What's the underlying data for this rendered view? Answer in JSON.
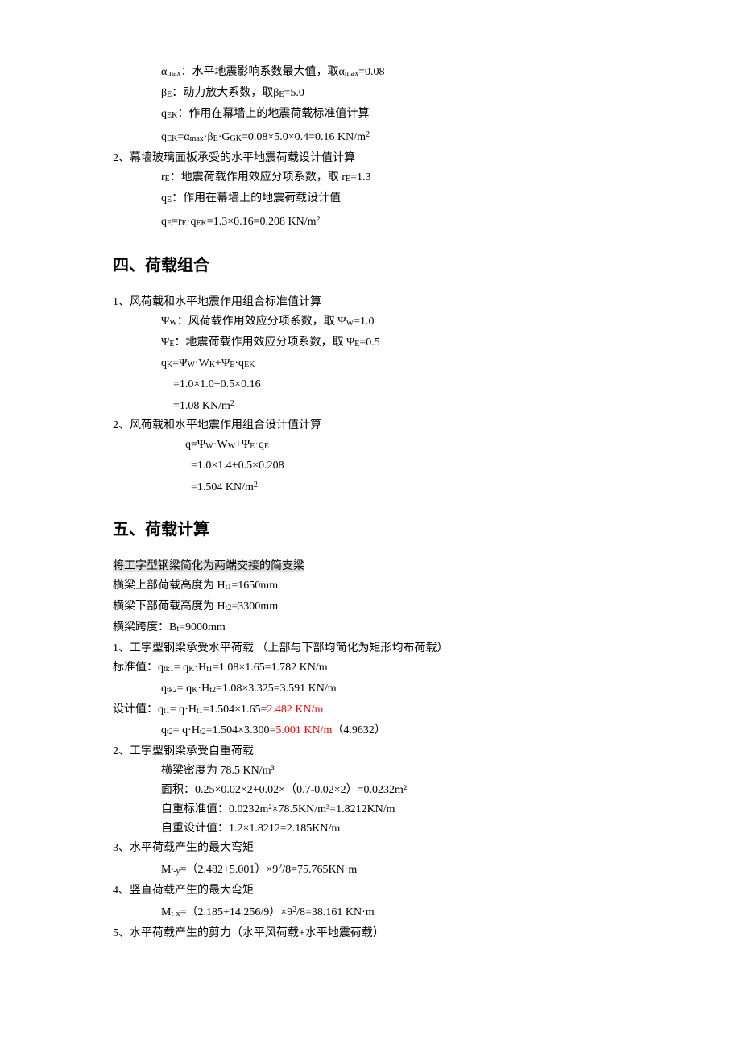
{
  "section3": {
    "lines": [
      {
        "cls": "indent-2",
        "text": "α_max：水平地震影响系数最大值，取α_max=0.08",
        "sub1": "max",
        "sub2": "max"
      },
      {
        "cls": "indent-2",
        "text": "β_E：动力放大系数，取β_E=5.0",
        "sub1": "E",
        "sub2": "E"
      },
      {
        "cls": "indent-2",
        "text": "q_EK：作用在幕墙上的地震荷载标准值计算",
        "sub1": "EK"
      },
      {
        "cls": "indent-2",
        "text": "q_EK=α_max ·β_E ·G_GK=0.08×5.0×0.4=0.16 KN/m²"
      }
    ],
    "line2_1": "2、幕墙玻璃面板承受的水平地震荷载设计值计算",
    "line2_2": "r_E：地震荷载作用效应分项系数，取 r_E=1.3",
    "line2_3": "q_E：作用在幕墙上的地震荷载设计值",
    "line2_4": "q_E=r_E ·q_EK=1.3×0.16=0.208 KN/m²"
  },
  "section4": {
    "title": "四、荷载组合",
    "l1": "1、风荷载和水平地震作用组合标准值计算",
    "l1_1": "Ψ_W：风荷载作用效应分项系数，取 Ψ_W=1.0",
    "l1_2": "Ψ_E：地震荷载作用效应分项系数，取 Ψ_E=0.5",
    "l1_3": "q_K=Ψ_W ·W_K+Ψ_E ·q_EK",
    "l1_4": "=1.0×1.0+0.5×0.16",
    "l1_5": "=1.08 KN/m²",
    "l2": "2、风荷载和水平地震作用组合设计值计算",
    "l2_1": "q=Ψ_W ·W_W+Ψ_E ·q_E",
    "l2_2": "=1.0×1.4+0.5×0.208",
    "l2_3": "=1.504 KN/m²"
  },
  "section5": {
    "title": "五、荷载计算",
    "hl": "将工字型钢梁简化为两端交接的简支梁",
    "a1": "横梁上部荷载高度为 H_t1=1650mm",
    "a2": "横梁下部荷载高度为 H_t2=3300mm",
    "a3": "横梁跨度：B_t=9000mm",
    "b0": "1、工字型钢梁承受水平荷载 （上部与下部均简化为矩形均布荷载）",
    "b1_pre": "标准值：q_tk1= q_K ·H_t1=1.08×1.65=1.782 KN/m",
    "b1_2": "q_tk2= q_K ·H_t2=1.08×3.325=3.591 KN/m",
    "b2_pre": "设计值：q_t1= q·H_t1=1.504×1.65=",
    "b2_red": "2.482 KN/m",
    "b2_2a": "q_t2= q·H_t2=1.504×3.300=",
    "b2_2red": "5.001 KN/m",
    "b2_2b": "（4.9632）",
    "c0": "2、工字型钢梁承受自重荷载",
    "c1": "横梁密度为 78.5 KN/m³",
    "c2": "面积：0.25×0.02×2+0.02×（0.7-0.02×2）=0.0232m²",
    "c3": "自重标准值：0.0232m²×78.5KN/m³=1.8212KN/m",
    "c4": "自重设计值：1.2×1.8212=2.185KN/m",
    "d0": "3、水平荷载产生的最大弯矩",
    "d1": "M_t-y=（2.482+5.001）×9²/8=75.765KN·m",
    "e0": "4、竖直荷载产生的最大弯矩",
    "e1": "M_t-x=（2.185+14.256/9）×9²/8=38.161 KN·m",
    "f0": "5、水平荷载产生的剪力（水平风荷载+水平地震荷载）"
  }
}
